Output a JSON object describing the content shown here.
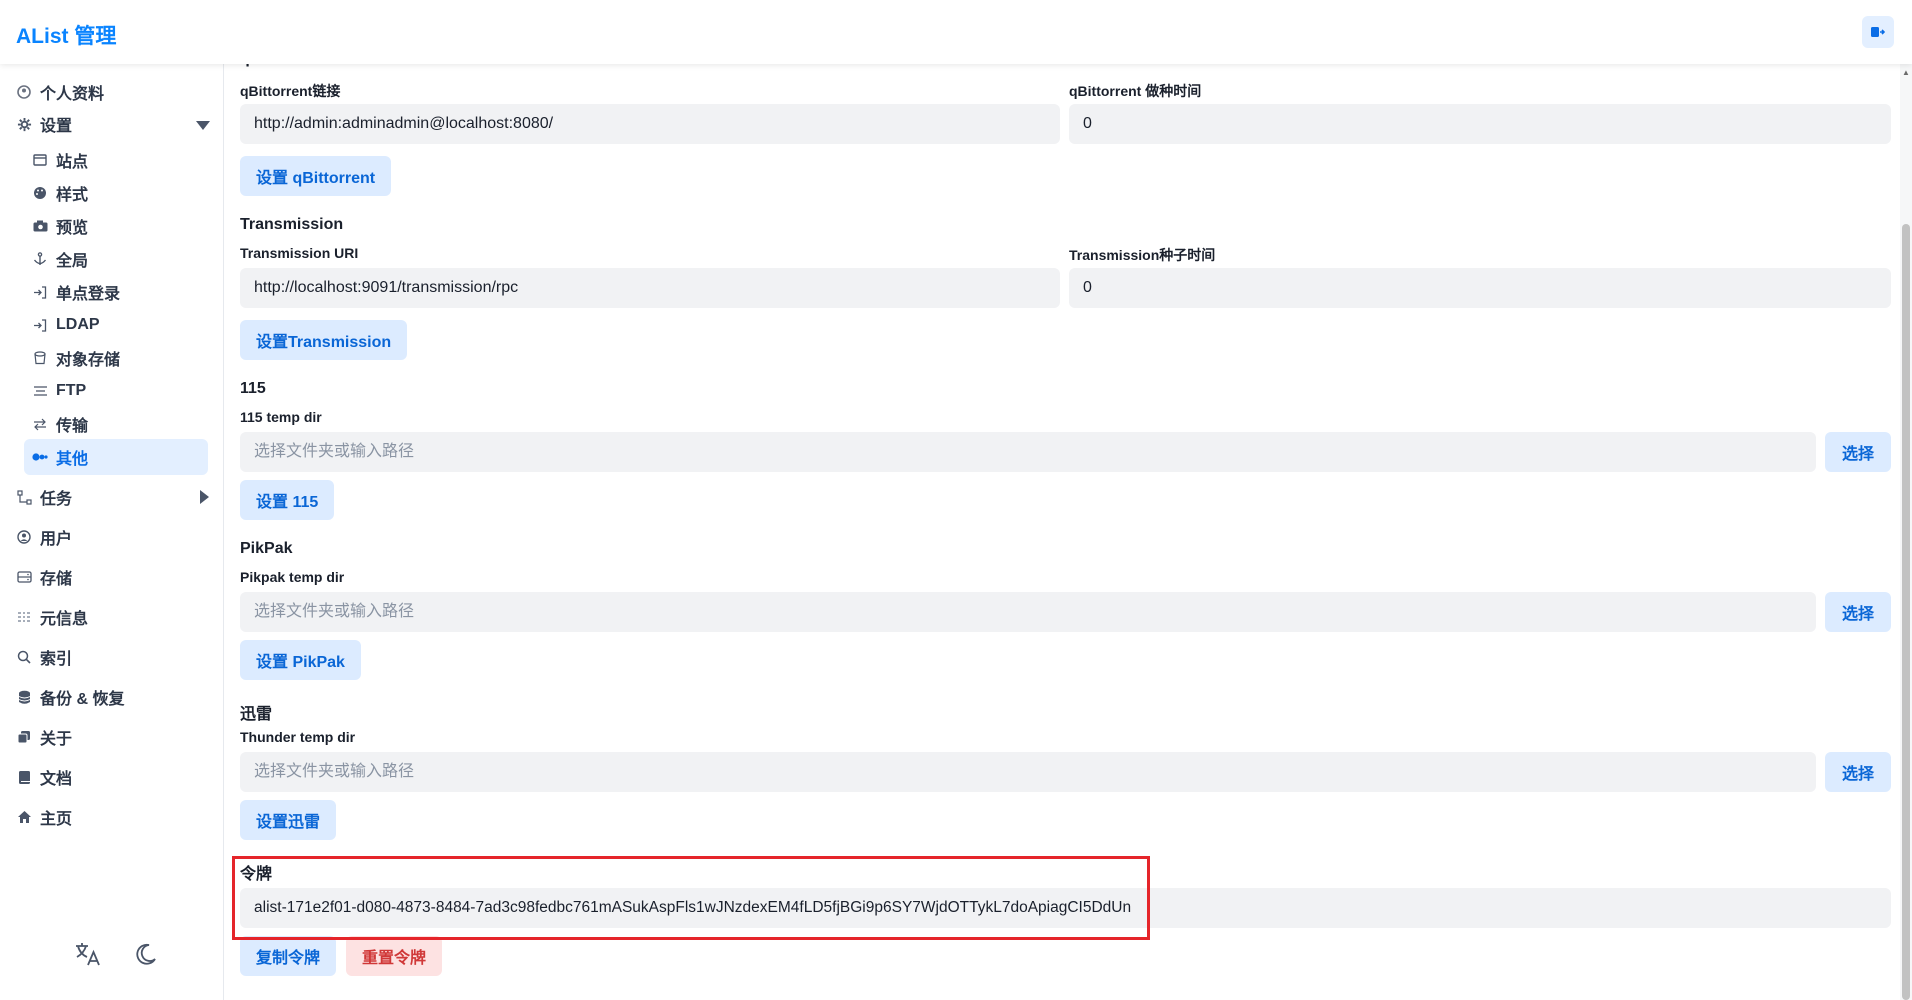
{
  "header": {
    "title": "AList 管理"
  },
  "sidebar": {
    "items": [
      {
        "label": "个人资料"
      },
      {
        "label": "设置"
      },
      {
        "label": "站点"
      },
      {
        "label": "样式"
      },
      {
        "label": "预览"
      },
      {
        "label": "全局"
      },
      {
        "label": "单点登录"
      },
      {
        "label": "LDAP"
      },
      {
        "label": "对象存储"
      },
      {
        "label": "FTP"
      },
      {
        "label": "传输"
      },
      {
        "label": "其他"
      },
      {
        "label": "任务"
      },
      {
        "label": "用户"
      },
      {
        "label": "存储"
      },
      {
        "label": "元信息"
      },
      {
        "label": "索引"
      },
      {
        "label": "备份 & 恢复"
      },
      {
        "label": "关于"
      },
      {
        "label": "文档"
      },
      {
        "label": "主页"
      }
    ]
  },
  "main": {
    "qbit": {
      "title": "qBittorrent",
      "url_label": "qBittorrent链接",
      "url_value": "http://admin:adminadmin@localhost:8080/",
      "seed_label": "qBittorrent 做种时间",
      "seed_value": "0",
      "button": "设置 qBittorrent"
    },
    "transmission": {
      "title": "Transmission",
      "uri_label": "Transmission URI",
      "uri_value": "http://localhost:9091/transmission/rpc",
      "seed_label": "Transmission种子时间",
      "seed_value": "0",
      "button": "设置Transmission"
    },
    "p115": {
      "title": "115",
      "dir_label": "115 temp dir",
      "placeholder": "选择文件夹或输入路径",
      "choose": "选择",
      "button": "设置 115"
    },
    "pikpak": {
      "title": "PikPak",
      "dir_label": "Pikpak temp dir",
      "placeholder": "选择文件夹或输入路径",
      "choose": "选择",
      "button": "设置 PikPak"
    },
    "thunder": {
      "title": "迅雷",
      "dir_label": "Thunder temp dir",
      "placeholder": "选择文件夹或输入路径",
      "choose": "选择",
      "button": "设置迅雷"
    },
    "token": {
      "title": "令牌",
      "value": "alist-171e2f01-d080-4873-8484-7ad3c98fedbc761mASukAspFls1wJNzdexEM4fLD5fjBGi9p6SY7WjdOTTykL7doApiagCI5DdUn",
      "copy": "复制令牌",
      "reset": "重置令牌"
    }
  },
  "colors": {
    "accent": "#0a84ff",
    "highlight": "#e5252a",
    "danger": "#d03838"
  }
}
